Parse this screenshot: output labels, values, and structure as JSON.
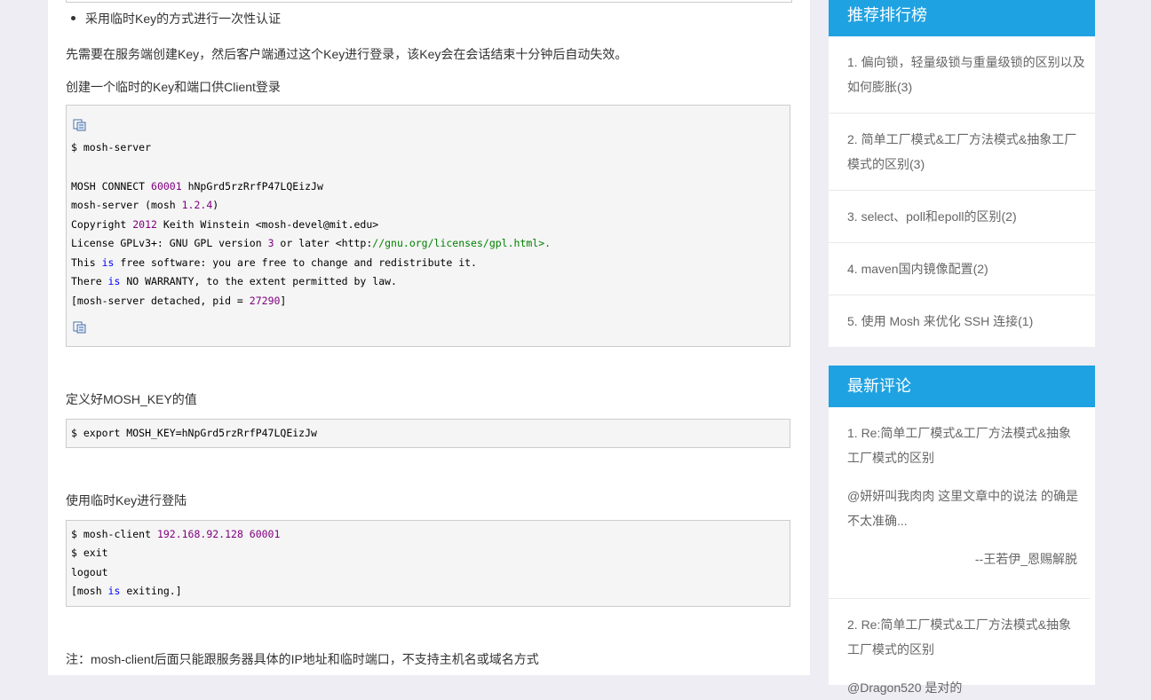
{
  "article": {
    "bullet": "采用临时Key的方式进行一次性认证",
    "p1": "先需要在服务端创建Key，然后客户端通过这个Key进行登录，该Key会在会话结束十分钟后自动失效。",
    "p2": "创建一个临时的Key和端口供Client登录",
    "p3": "定义好MOSH_KEY的值",
    "p4": "使用临时Key进行登陆",
    "p5": "注：mosh-client后面只能跟服务器具体的IP地址和临时端口，不支持主机名或域名方式"
  },
  "code1": {
    "l1": "$ mosh-server",
    "l2a": "MOSH CONNECT ",
    "l2n": "60001",
    "l2b": " hNpGrd5rzRrfP47LQEizJw",
    "l3a": "mosh-server (mosh ",
    "l3n": "1.2.4",
    "l3b": ")",
    "l4a": "Copyright ",
    "l4n": "2012",
    "l4b": " Keith Winstein <mosh-devel@mit.edu>",
    "l5a": "License GPLv3+: GNU GPL version ",
    "l5n": "3",
    "l5b": " or later <http:",
    "l5s": "//gnu.org/licenses/gpl.html>.",
    "l6a": "This ",
    "l6k": "is",
    "l6b": " free software: you are free to change and redistribute it.",
    "l7a": "There ",
    "l7k": "is",
    "l7b": " NO WARRANTY, to the extent permitted by law.",
    "l8a": "[mosh-server detached, pid = ",
    "l8n": "27290",
    "l8b": "]"
  },
  "code2": {
    "l1": "$ export MOSH_KEY=hNpGrd5rzRrfP47LQEizJw"
  },
  "code3": {
    "l1a": "$ mosh-client ",
    "l1n": "192.168.92.128 60001",
    "l2": "$ exit",
    "l3": "logout",
    "l4a": "[mosh ",
    "l4k": "is",
    "l4b": " exiting.]"
  },
  "rank": {
    "title": "推荐排行榜",
    "items": [
      {
        "line1": "1. 偏向锁，轻量级锁与重量级锁的区别以及",
        "line2": "如何膨胀(3)"
      },
      {
        "line1": "2. 简单工厂模式&工厂方法模式&抽象工厂",
        "line2": "模式的区别(3)"
      },
      {
        "line1": "3. select、poll和epoll的区别(2)"
      },
      {
        "line1": "4. maven国内镜像配置(2)"
      },
      {
        "line1": "5. 使用 Mosh 来优化 SSH 连接(1)"
      }
    ]
  },
  "comments": {
    "title": "最新评论",
    "items": [
      {
        "t1": "1. Re:简单工厂模式&工厂方法模式&抽象",
        "t2": "工厂模式的区别",
        "b1": "@妍妍叫我肉肉 这里文章中的说法 的确是",
        "b2": "不太准确...",
        "author": "--王若伊_恩赐解脱"
      },
      {
        "t1": "2. Re:简单工厂模式&工厂方法模式&抽象",
        "t2": "工厂模式的区别",
        "b1": "@Dragon520 是对的"
      }
    ]
  }
}
